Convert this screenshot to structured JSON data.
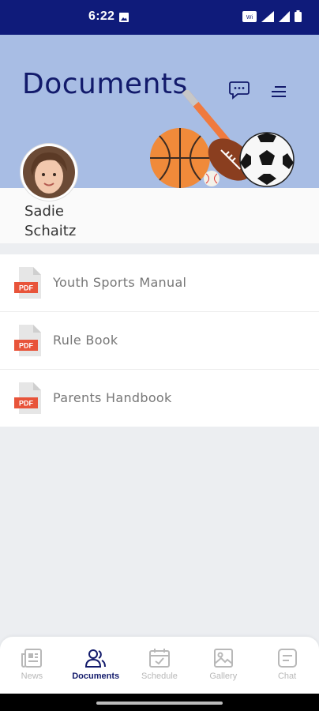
{
  "status_bar": {
    "time": "6:22"
  },
  "header": {
    "title": "Documents"
  },
  "profile": {
    "first_name": "Sadie",
    "last_name": "Schaitz"
  },
  "documents": [
    {
      "label": "Youth Sports Manual",
      "icon": "pdf-icon",
      "badge": "PDF"
    },
    {
      "label": "Rule Book",
      "icon": "pdf-icon",
      "badge": "PDF"
    },
    {
      "label": "Parents Handbook",
      "icon": "pdf-icon",
      "badge": "PDF"
    }
  ],
  "bottom_nav": [
    {
      "label": "News",
      "icon": "news-icon",
      "active": false
    },
    {
      "label": "Documents",
      "icon": "documents-icon",
      "active": true
    },
    {
      "label": "Schedule",
      "icon": "schedule-icon",
      "active": false
    },
    {
      "label": "Gallery",
      "icon": "gallery-icon",
      "active": false
    },
    {
      "label": "Chat",
      "icon": "chat-icon",
      "active": false
    }
  ],
  "colors": {
    "status_bar": "#0f1b7a",
    "header_bg": "#a8bde4",
    "title": "#121a6b",
    "pdf_red": "#e8543a",
    "nav_active": "#121a6b",
    "nav_inactive": "#b8b8b8"
  }
}
